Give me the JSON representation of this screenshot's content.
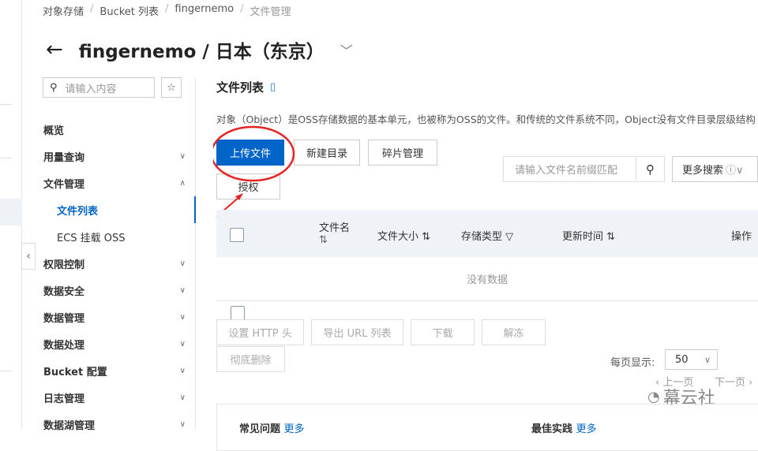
{
  "breadcrumb": [
    "对象存储",
    "Bucket 列表",
    "fingernemo",
    "文件管理"
  ],
  "title": "fingernemo / 日本（东京）",
  "nav_search_placeholder": "请输入内容",
  "nav": [
    {
      "label": "概览"
    },
    {
      "label": "用量查询"
    },
    {
      "label": "文件管理"
    },
    {
      "label": "文件列表"
    },
    {
      "label": "ECS 挂载 OSS"
    },
    {
      "label": "权限控制"
    },
    {
      "label": "数据安全"
    },
    {
      "label": "数据管理"
    },
    {
      "label": "数据处理"
    },
    {
      "label": "Bucket 配置"
    },
    {
      "label": "日志管理"
    },
    {
      "label": "数据湖管理"
    }
  ],
  "section_title": "文件列表",
  "description": "对象（Object）是OSS存储数据的基本单元，也被称为OSS的文件。和传统的文件系统不同，Object没有文件目录层级结构",
  "buttons": {
    "upload": "上传文件",
    "new_dir": "新建目录",
    "fragments": "碎片管理",
    "authorize": "授权"
  },
  "file_search_placeholder": "请输入文件名前缀匹配",
  "more_search": "更多搜索",
  "columns": [
    "文件名",
    "文件大小",
    "存储类型",
    "更新时间",
    "操作"
  ],
  "empty_text": "没有数据",
  "bulk": {
    "http": "设置 HTTP 头",
    "export": "导出 URL 列表",
    "download": "下载",
    "unfreeze": "解冻",
    "delete": "彻底删除"
  },
  "page_size_label": "每页显示:",
  "page_size": "50",
  "prev": "上一页",
  "next": "下一页",
  "watermark": "幕云社",
  "cards": {
    "faq": "常见问题",
    "best": "最佳实践",
    "more": "更多"
  }
}
